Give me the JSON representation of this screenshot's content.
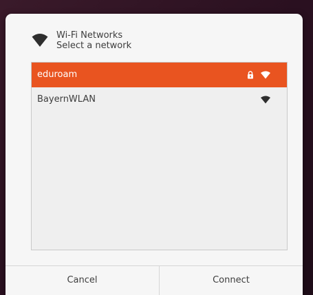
{
  "dialog": {
    "title": "Wi-Fi Networks",
    "subtitle": "Select a network",
    "header_icon": "wifi-icon"
  },
  "networks": [
    {
      "name": "eduroam",
      "secured": true,
      "selected": true,
      "icons": [
        "lock-icon",
        "wifi-signal-icon"
      ]
    },
    {
      "name": "BayernWLAN",
      "secured": false,
      "selected": false,
      "icons": [
        "wifi-signal-icon"
      ]
    }
  ],
  "buttons": {
    "cancel": "Cancel",
    "connect": "Connect"
  },
  "colors": {
    "accent": "#e95420",
    "dialog_bg": "#f6f6f6",
    "list_bg": "#efefef",
    "text": "#3d3d3d",
    "selected_text": "#ffffff"
  }
}
